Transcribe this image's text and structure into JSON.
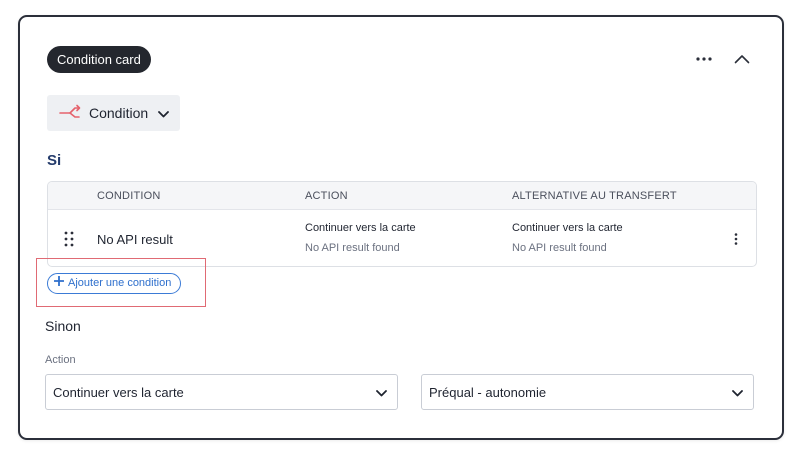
{
  "card": {
    "pill_label": "Condition card",
    "condition_select_label": "Condition"
  },
  "si": {
    "label": "Si",
    "columns": [
      "CONDITION",
      "ACTION",
      "ALTERNATIVE AU TRANSFERT"
    ],
    "rows": [
      {
        "name": "No API result",
        "action_main": "Continuer vers la carte",
        "action_sub": "No API result found",
        "alt_main": "Continuer vers la carte",
        "alt_sub": "No API result found"
      }
    ],
    "add_condition_label": "Ajouter une condition"
  },
  "sinon": {
    "label": "Sinon",
    "action_label": "Action",
    "action_select_value": "Continuer vers la carte",
    "second_select_value": "Préqual - autonomie"
  },
  "icons": {
    "more": "more-horizontal-icon",
    "collapse": "chevron-up-icon",
    "branch": "branch-icon",
    "drag": "drag-handle-icon",
    "kebab": "more-vertical-icon",
    "plus": "plus-icon",
    "dropdown": "chevron-down-icon"
  },
  "colors": {
    "pill_bg": "#24272e",
    "si_label": "#243b6b",
    "add_button": "#3b7bd6",
    "branch_icon": "#e5626c",
    "highlight": "#e06a74"
  }
}
